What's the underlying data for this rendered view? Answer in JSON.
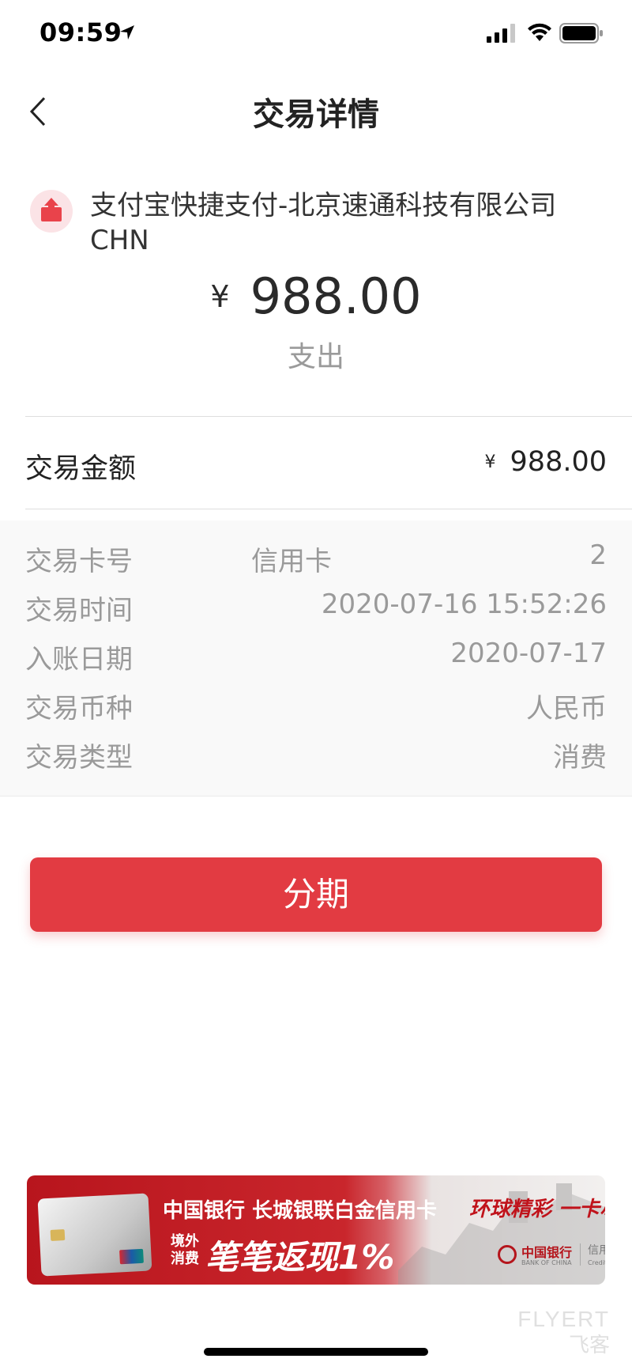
{
  "status_bar": {
    "time": "09:59"
  },
  "nav": {
    "title": "交易详情"
  },
  "merchant": {
    "name": "支付宝快捷支付-北京速通科技有限公司",
    "country": "CHN",
    "currency_symbol": "¥",
    "amount": "988.00",
    "direction": "支出"
  },
  "summary": {
    "label": "交易金额",
    "currency_symbol": "¥",
    "value": "988.00"
  },
  "details": [
    {
      "label": "交易卡号",
      "middle": "信用卡",
      "value": "2"
    },
    {
      "label": "交易时间",
      "value": "2020-07-16 15:52:26"
    },
    {
      "label": "入账日期",
      "value": "2020-07-17"
    },
    {
      "label": "交易币种",
      "value": "人民币"
    },
    {
      "label": "交易类型",
      "value": "消费"
    }
  ],
  "actions": {
    "installment_label": "分期"
  },
  "banner": {
    "title": "中国银行 长城银联白金信用卡",
    "tag_line1": "境外",
    "tag_line2": "消费",
    "cashback": "笔笔返现1%",
    "slogan": "环球精彩 一卡尽享",
    "bank_name_cn": "中国银行",
    "bank_name_en": "BANK OF CHINA",
    "card_type_cn": "信用卡",
    "card_type_en": "Credit Card"
  },
  "watermark": {
    "en": "FLYERT",
    "cn": "飞客"
  },
  "colors": {
    "accent": "#e23b42",
    "muted_text": "#9a9a9a",
    "banner_red": "#c9262c"
  }
}
